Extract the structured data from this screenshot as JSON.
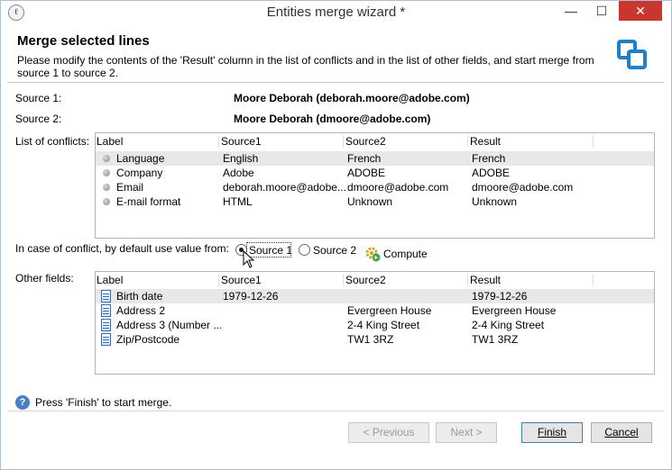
{
  "window": {
    "title": "Entities merge wizard *",
    "minimize": "—",
    "maximize": "☐",
    "close": "✕"
  },
  "header": {
    "title": "Merge selected lines",
    "description": "Please modify the contents of the 'Result' column in the list of conflicts and in the list of other fields, and start merge from source 1 to source 2."
  },
  "sources": {
    "source1_label": "Source 1:",
    "source1_value": "Moore Deborah (deborah.moore@adobe.com)",
    "source2_label": "Source 2:",
    "source2_value": "Moore Deborah (dmoore@adobe.com)"
  },
  "conflicts": {
    "label": "List of conflicts:",
    "columns": [
      "Label",
      "Source1",
      "Source2",
      "Result"
    ],
    "rows": [
      [
        "Language",
        "English",
        "French",
        "French"
      ],
      [
        "Company",
        "Adobe",
        "ADOBE",
        "ADOBE"
      ],
      [
        "Email",
        "deborah.moore@adobe...",
        "dmoore@adobe.com",
        "dmoore@adobe.com"
      ],
      [
        "E-mail format",
        "HTML",
        "Unknown",
        "Unknown"
      ]
    ]
  },
  "default_choice": {
    "label": "In case of conflict, by default use value from:",
    "option1": "Source 1",
    "option2": "Source 2",
    "compute": "Compute",
    "selected": "Source 1"
  },
  "other_fields": {
    "label": "Other fields:",
    "columns": [
      "Label",
      "Source1",
      "Source2",
      "Result"
    ],
    "rows": [
      [
        "Birth date",
        "1979-12-26",
        "",
        "1979-12-26"
      ],
      [
        "Address 2",
        "",
        "Evergreen House",
        "Evergreen House"
      ],
      [
        "Address 3 (Number ...",
        "",
        "2-4 King Street",
        "2-4 King Street"
      ],
      [
        "Zip/Postcode",
        "",
        "TW1 3RZ",
        "TW1 3RZ"
      ]
    ]
  },
  "footer": {
    "hint": "Press 'Finish' to start merge.",
    "previous": "< Previous",
    "next": "Next >",
    "finish": "Finish",
    "cancel": "Cancel"
  },
  "colors": {
    "accent": "#1f7fc8",
    "close": "#c7372f",
    "selected_row": "#e8e8e8"
  }
}
